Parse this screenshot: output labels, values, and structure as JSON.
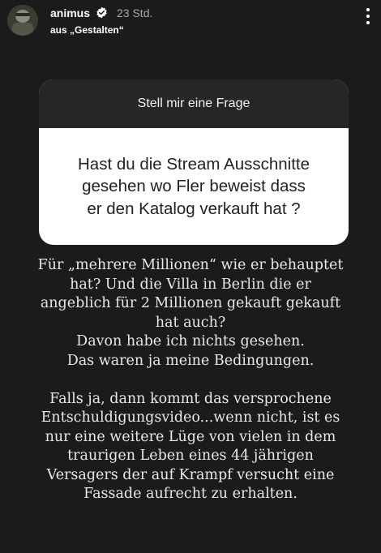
{
  "header": {
    "username": "animus",
    "time": "23 Std.",
    "subtitle": "aus „Gestalten“",
    "icons": {
      "avatar": "profile-avatar",
      "verified": "verified-badge-icon",
      "more": "more-options-icon"
    }
  },
  "question_sticker": {
    "title": "Stell mir eine Frage",
    "question": "Hast du die Stream Ausschnitte\ngesehen wo Fler beweist dass\ner den Katalog verkauft hat ?"
  },
  "answer": {
    "text": "Für „mehrere Millionen“ wie er behauptet\nhat? Und die Villa in Berlin die er\nangeblich für 2 Millionen gekauft gekauft\nhat auch?\nDavon habe ich nichts gesehen.\nDas waren ja meine Bedingungen.\n\nFalls ja, dann kommt das versprochene\nEntschuldigungsvideo...wenn nicht, ist es\nnur eine weitere Lüge von vielen in dem\ntraurigen Leben eines 44 jährigen\nVersagers der auf Krampf versucht eine\nFassade aufrecht zu erhalten."
  },
  "colors": {
    "background": "#1b1b1b",
    "sticker_header": "#262626",
    "sticker_body": "#ffffff",
    "secondary_text": "#a8a8a8"
  }
}
